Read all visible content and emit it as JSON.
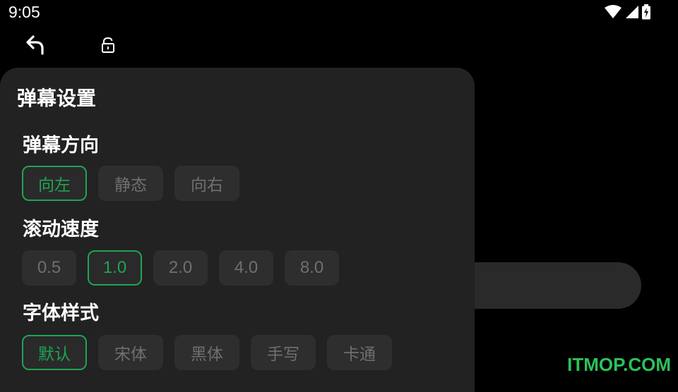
{
  "status_bar": {
    "time": "9:05",
    "icons": [
      "wifi-icon",
      "signal-icon",
      "battery-charging-icon"
    ]
  },
  "top_bar": {
    "back_icon": "back-arrow-icon",
    "lock_icon": "unlock-icon"
  },
  "panel": {
    "title": "弹幕设置",
    "direction": {
      "label": "弹幕方向",
      "options": [
        "向左",
        "静态",
        "向右"
      ],
      "selected": "向左"
    },
    "speed": {
      "label": "滚动速度",
      "options": [
        "0.5",
        "1.0",
        "2.0",
        "4.0",
        "8.0"
      ],
      "selected": "1.0"
    },
    "font": {
      "label": "字体样式",
      "options": [
        "默认",
        "宋体",
        "黑体",
        "手写",
        "卡通"
      ],
      "selected": "默认"
    }
  },
  "colors": {
    "accent": "#1fa453",
    "panel_bg": "#222222",
    "option_bg": "#2e2e2e",
    "option_text": "#6f6f6f"
  },
  "watermark": "ITMOP.COM"
}
